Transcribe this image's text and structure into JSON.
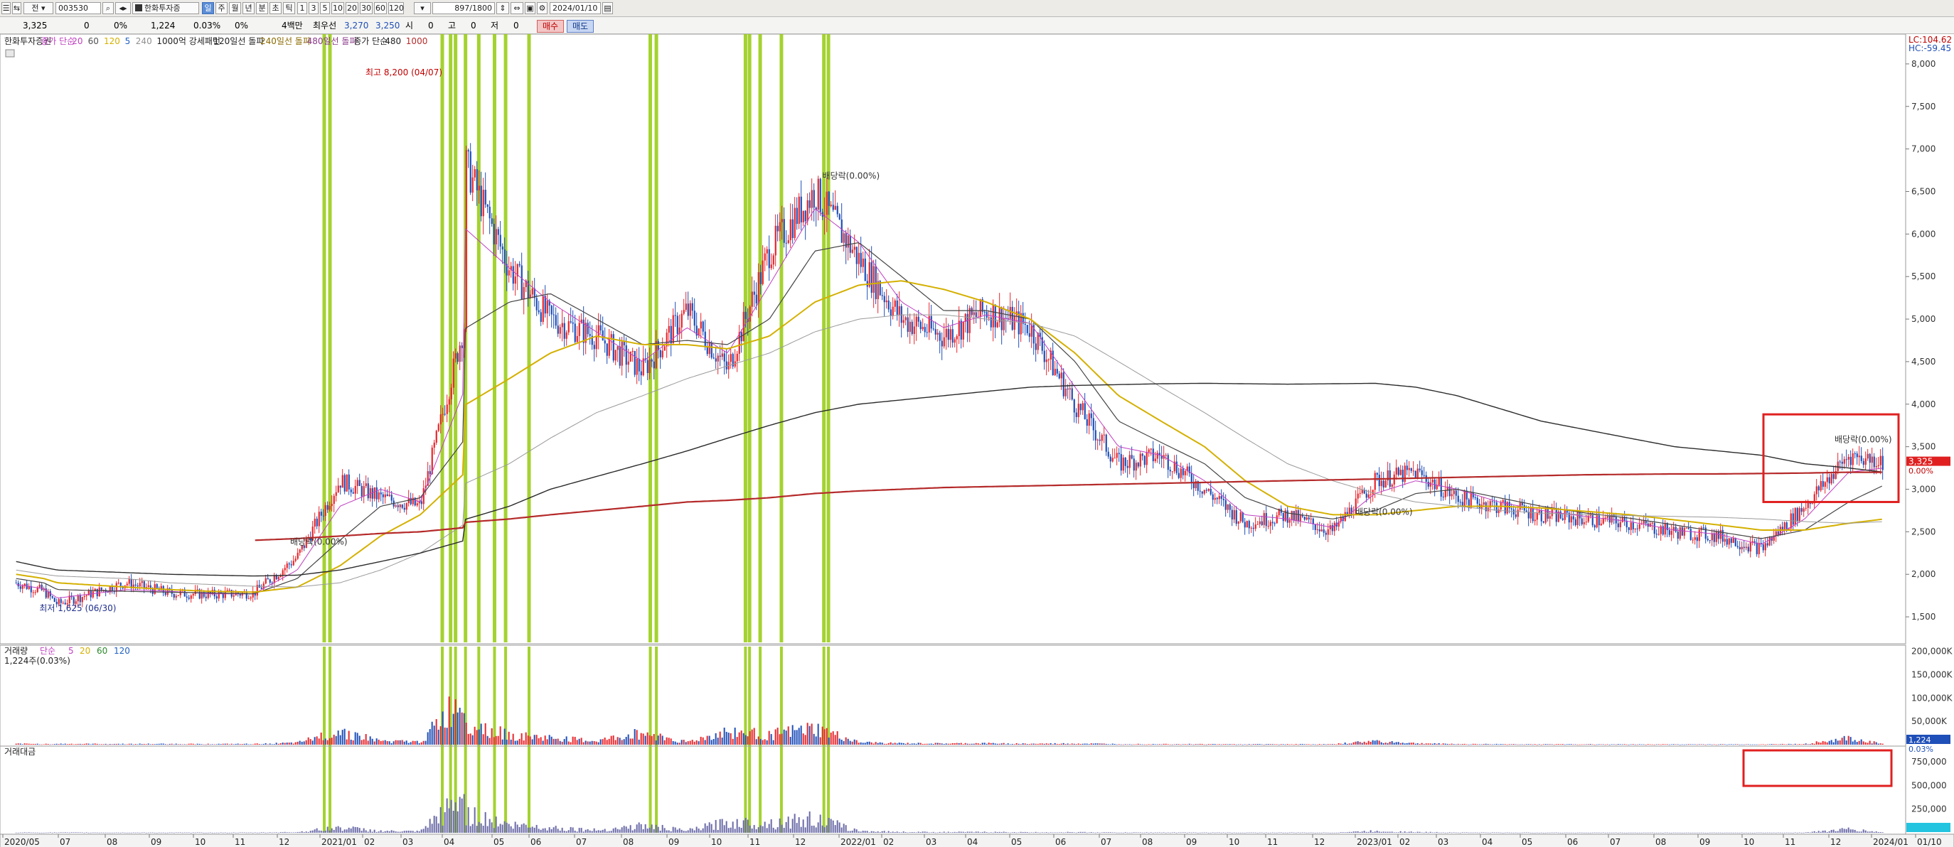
{
  "toolbar": {
    "market": "전",
    "code": "003530",
    "name": "한화투자증",
    "periods": [
      "일",
      "주",
      "월",
      "년",
      "분",
      "초",
      "틱"
    ],
    "selected_period": "일",
    "intervals": [
      "1",
      "3",
      "5",
      "10",
      "20",
      "30",
      "60",
      "120"
    ],
    "count_display": "897/1800",
    "date": "2024/01/10"
  },
  "quote": {
    "price": "3,325",
    "change": "0",
    "change_pct": "0%",
    "volume": "1,224",
    "volume_pct": "0.03%",
    "vol_change": "0%",
    "unit_label": "4백만",
    "pref_label": "최우선",
    "ask": "3,270",
    "bid": "3,250",
    "open_label": "시",
    "open": "0",
    "high_label": "고",
    "high": "0",
    "low_label": "저",
    "low": "0",
    "buy_label": "매수",
    "sell_label": "매도"
  },
  "legend": {
    "stock_name": "한화투자증권",
    "price_ma_label": "종가 단순",
    "ma_periods": [
      "20",
      "60",
      "120",
      "5",
      "240"
    ],
    "ma_colors": [
      "#c040c0",
      "#505050",
      "#d4b000",
      "#2060c0",
      "#909090"
    ],
    "pattern_label": "1000억 강세패턴",
    "break_120": "120일선 돌파",
    "break_240": "240일선 돌파",
    "break_480": "480일선 돌파",
    "long_ma_label": "종가 단순",
    "long_ma_periods": [
      "480",
      "1000"
    ],
    "high_note": "최고 8,200 (04/07)",
    "low_note": "최저 1,625 (06/30)",
    "dividend_notes": [
      "배당락(0.00%)",
      "배당락(0.00%)",
      "배당락(0.00%)",
      "배당락(0.00%)"
    ],
    "lc": "LC:104.62",
    "hc": "HC:-59.45",
    "current_price_tag": "3,325",
    "current_pct_tag": "0.00%"
  },
  "volume_panel": {
    "title": "거래량",
    "ma_label": "단순",
    "ma_periods": [
      "5",
      "20",
      "60",
      "120"
    ],
    "value_text": "1,224주(0.03%)",
    "current_tag": "1,224",
    "current_pct_tag": "0.03%",
    "y_ticks": [
      "200,000K",
      "150,000K",
      "100,000K",
      "50,000K"
    ]
  },
  "amount_panel": {
    "title": "거래대금",
    "y_ticks": [
      "750,000",
      "500,000",
      "250,000"
    ]
  },
  "colors": {
    "up": "#e8262c",
    "down": "#1f4fb8",
    "signal": "#9acd1a",
    "ma1000": "#b52a2a",
    "highlight_box": "#e02020"
  },
  "chart_data": {
    "type": "candlestick",
    "y_ticks": [
      1500,
      2000,
      2500,
      3000,
      3500,
      4000,
      4500,
      5000,
      5500,
      6000,
      6500,
      7000,
      7500,
      8000
    ],
    "ylim": [
      1200,
      8300
    ],
    "x_tick_labels": [
      "2020/05",
      "07",
      "08",
      "09",
      "10",
      "11",
      "12",
      "2021/01",
      "02",
      "03",
      "04",
      "05",
      "06",
      "07",
      "08",
      "09",
      "10",
      "11",
      "12",
      "2022/01",
      "02",
      "03",
      "04",
      "05",
      "06",
      "07",
      "08",
      "09",
      "10",
      "11",
      "12",
      "2023/01",
      "02",
      "03",
      "04",
      "05",
      "06",
      "07",
      "08",
      "09",
      "10",
      "11",
      "12",
      "2024/01",
      "01/10"
    ],
    "price_series": {
      "name": "종가",
      "x": [
        "2020/05",
        "2020/06",
        "2020/06/30",
        "2020/08",
        "2020/09",
        "2020/10",
        "2020/11",
        "2020/12",
        "2021/01",
        "2021/02",
        "2021/03",
        "2021/04",
        "2021/04/07",
        "2021/05",
        "2021/06",
        "2021/07",
        "2021/08",
        "2021/09",
        "2021/10",
        "2021/11",
        "2021/12",
        "2022/01",
        "2022/02",
        "2022/03",
        "2022/04",
        "2022/05",
        "2022/06",
        "2022/07",
        "2022/08",
        "2022/09",
        "2022/10",
        "2022/11",
        "2022/12",
        "2023/01",
        "2023/02",
        "2023/03",
        "2023/04",
        "2023/05",
        "2023/06",
        "2023/07",
        "2023/08",
        "2023/09",
        "2023/10",
        "2023/11",
        "2023/12",
        "2024/01/10"
      ],
      "values": [
        1900,
        1800,
        1650,
        1900,
        1780,
        1760,
        1780,
        2200,
        3100,
        2900,
        2800,
        5000,
        7200,
        5600,
        5000,
        4800,
        4400,
        5100,
        4400,
        5800,
        6500,
        5700,
        5000,
        4800,
        5100,
        4900,
        4000,
        3300,
        3400,
        3000,
        2600,
        2700,
        2500,
        3100,
        3200,
        2900,
        2800,
        2700,
        2650,
        2600,
        2500,
        2450,
        2300,
        2800,
        3400,
        3325
      ]
    },
    "moving_averages": [
      {
        "name": "20",
        "values": [
          1880,
          1830,
          1720,
          1820,
          1800,
          1770,
          1770,
          2050,
          2800,
          3000,
          2850,
          4200,
          6200,
          5600,
          5200,
          4850,
          4500,
          4900,
          4600,
          5400,
          6300,
          5900,
          5200,
          4900,
          5050,
          4950,
          4200,
          3500,
          3400,
          3100,
          2700,
          2650,
          2550,
          2950,
          3100,
          3000,
          2850,
          2750,
          2680,
          2620,
          2520,
          2470,
          2350,
          2650,
          3200,
          3250
        ]
      },
      {
        "name": "60",
        "values": [
          1950,
          1900,
          1820,
          1800,
          1790,
          1780,
          1770,
          1950,
          2400,
          2800,
          2900,
          3600,
          4800,
          5200,
          5300,
          5000,
          4700,
          4750,
          4700,
          5000,
          5800,
          5900,
          5500,
          5100,
          5100,
          5000,
          4500,
          3800,
          3550,
          3300,
          2900,
          2720,
          2650,
          2750,
          2950,
          3000,
          2900,
          2800,
          2720,
          2660,
          2580,
          2500,
          2420,
          2520,
          2850,
          3050
        ]
      },
      {
        "name": "120",
        "values": [
          2000,
          1950,
          1900,
          1850,
          1820,
          1800,
          1790,
          1850,
          2100,
          2450,
          2700,
          3200,
          3900,
          4300,
          4600,
          4800,
          4700,
          4700,
          4650,
          4800,
          5200,
          5400,
          5450,
          5350,
          5200,
          5000,
          4600,
          4100,
          3800,
          3500,
          3100,
          2800,
          2700,
          2700,
          2750,
          2800,
          2800,
          2780,
          2740,
          2700,
          2640,
          2580,
          2520,
          2520,
          2600,
          2650
        ]
      },
      {
        "name": "240",
        "values": [
          2050,
          2000,
          1980,
          1950,
          1900,
          1880,
          1860,
          1850,
          1900,
          2050,
          2250,
          2600,
          3000,
          3300,
          3600,
          3900,
          4100,
          4300,
          4450,
          4600,
          4850,
          5000,
          5050,
          5050,
          5000,
          4950,
          4800,
          4500,
          4200,
          3900,
          3600,
          3300,
          3100,
          2950,
          2850,
          2800,
          2750,
          2720,
          2700,
          2690,
          2680,
          2670,
          2650,
          2620,
          2600,
          2620
        ]
      },
      {
        "name": "480",
        "values": [
          2150,
          2080,
          2050,
          2020,
          2000,
          1990,
          1980,
          1990,
          2050,
          2150,
          2250,
          2400,
          2600,
          2800,
          3000,
          3150,
          3300,
          3450,
          3600,
          3750,
          3900,
          4000,
          4050,
          4100,
          4150,
          4200,
          4220,
          4230,
          4240,
          4245,
          4240,
          4235,
          4240,
          4245,
          4200,
          4100,
          3950,
          3800,
          3700,
          3600,
          3500,
          3450,
          3400,
          3300,
          3250,
          3200
        ]
      },
      {
        "name": "1000",
        "values": [
          null,
          null,
          null,
          null,
          null,
          null,
          2400,
          2420,
          2450,
          2480,
          2500,
          2550,
          2600,
          2650,
          2700,
          2750,
          2800,
          2850,
          2870,
          2900,
          2950,
          2980,
          3000,
          3020,
          3030,
          3040,
          3050,
          3060,
          3070,
          3080,
          3090,
          3100,
          3110,
          3120,
          3130,
          3140,
          3150,
          3160,
          3170,
          3175,
          3180,
          3180,
          3185,
          3190,
          3200,
          3200
        ]
      }
    ],
    "signal_dates": [
      "2021/01/04",
      "2021/01/08",
      "2021/04/01",
      "2021/04/06",
      "2021/04/09",
      "2021/04/15",
      "2021/04/23",
      "2021/05/03",
      "2021/05/12",
      "2021/06/01",
      "2021/08/20",
      "2021/08/24",
      "2021/10/29",
      "2021/11/02",
      "2021/11/09",
      "2021/11/23",
      "2021/12/21",
      "2021/12/24"
    ],
    "volume": {
      "unit": "K",
      "ylim": [
        0,
        210000
      ],
      "values": [
        2000,
        1500,
        1800,
        1600,
        1700,
        1500,
        1600,
        4000,
        30000,
        8000,
        6000,
        110000,
        60000,
        20000,
        15000,
        8000,
        26000,
        6000,
        28000,
        22000,
        35000,
        5000,
        3000,
        2500,
        3000,
        2000,
        2500,
        1500,
        1500,
        1200,
        1000,
        1200,
        1000,
        8000,
        3000,
        1500,
        1200,
        1000,
        1000,
        900,
        900,
        800,
        900,
        1500,
        14000,
        1224
      ]
    },
    "amount": {
      "ylim": [
        0,
        900000
      ],
      "values": [
        5000,
        3000,
        4000,
        3000,
        3000,
        3000,
        3000,
        8000,
        60000,
        20000,
        15000,
        420000,
        250000,
        90000,
        60000,
        30000,
        80000,
        25000,
        120000,
        110000,
        160000,
        20000,
        10000,
        8000,
        9000,
        6000,
        7000,
        4000,
        4000,
        3000,
        2500,
        3000,
        2500,
        20000,
        8000,
        4000,
        3000,
        2500,
        2500,
        2200,
        2200,
        2000,
        2000,
        3500,
        40000,
        4000
      ]
    }
  }
}
